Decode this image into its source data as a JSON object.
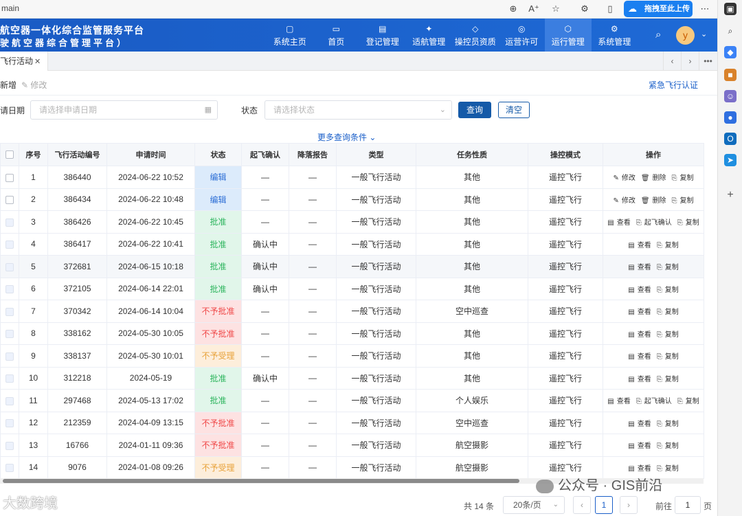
{
  "browser": {
    "url": "main",
    "upload_label": "拖拽至此上传"
  },
  "app": {
    "title_line1": "航空器一体化综合监管服务平台",
    "title_line2": "驶航空器综合管理平台）",
    "user_initial": "y"
  },
  "nav": [
    {
      "label": "系统主页",
      "icon": "home-screen-icon"
    },
    {
      "label": "首页",
      "icon": "monitor-icon"
    },
    {
      "label": "登记管理",
      "icon": "register-icon"
    },
    {
      "label": "适航管理",
      "icon": "drone-icon"
    },
    {
      "label": "操控员资质",
      "icon": "shield-icon"
    },
    {
      "label": "运营许可",
      "icon": "license-icon"
    },
    {
      "label": "运行管理",
      "icon": "operation-icon",
      "active": true
    },
    {
      "label": "系统管理",
      "icon": "gear-icon"
    }
  ],
  "tabs": {
    "active_tab": "飞行活动"
  },
  "toolbar": {
    "add_label": "新增",
    "edit_label": "修改",
    "emergency_label": "紧急飞行认证"
  },
  "search": {
    "date_label": "请日期",
    "date_placeholder": "请选择申请日期",
    "status_label": "状态",
    "status_placeholder": "请选择状态",
    "query_label": "查询",
    "clear_label": "清空",
    "more_label": "更多查询条件"
  },
  "table": {
    "headers": [
      "序号",
      "飞行活动编号",
      "申请时间",
      "状态",
      "起飞确认",
      "降落报告",
      "类型",
      "任务性质",
      "操控模式",
      "操作"
    ],
    "rows": [
      {
        "no": "1",
        "id": "386440",
        "time": "2024-06-22 10:52",
        "status": "编辑",
        "status_type": "edit",
        "takeoff": "—",
        "landing": "—",
        "type": "一般飞行活动",
        "task": "其他",
        "mode": "遥控飞行",
        "ops": [
          "修改",
          "删除",
          "复制"
        ],
        "checkbox": "on"
      },
      {
        "no": "2",
        "id": "386434",
        "time": "2024-06-22 10:48",
        "status": "编辑",
        "status_type": "edit",
        "takeoff": "—",
        "landing": "—",
        "type": "一般飞行活动",
        "task": "其他",
        "mode": "遥控飞行",
        "ops": [
          "修改",
          "删除",
          "复制"
        ],
        "checkbox": "on"
      },
      {
        "no": "3",
        "id": "386426",
        "time": "2024-06-22 10:45",
        "status": "批准",
        "status_type": "ok",
        "takeoff": "—",
        "landing": "—",
        "type": "一般飞行活动",
        "task": "其他",
        "mode": "遥控飞行",
        "ops": [
          "查看",
          "起飞确认",
          "复制"
        ],
        "checkbox": "dis"
      },
      {
        "no": "4",
        "id": "386417",
        "time": "2024-06-22 10:41",
        "status": "批准",
        "status_type": "ok",
        "takeoff": "确认中",
        "landing": "—",
        "type": "一般飞行活动",
        "task": "其他",
        "mode": "遥控飞行",
        "ops": [
          "查看",
          "复制"
        ],
        "checkbox": "dis"
      },
      {
        "no": "5",
        "id": "372681",
        "time": "2024-06-15 10:18",
        "status": "批准",
        "status_type": "ok",
        "takeoff": "确认中",
        "landing": "—",
        "type": "一般飞行活动",
        "task": "其他",
        "mode": "遥控飞行",
        "ops": [
          "查看",
          "复制"
        ],
        "checkbox": "dis",
        "highlight": true
      },
      {
        "no": "6",
        "id": "372105",
        "time": "2024-06-14 22:01",
        "status": "批准",
        "status_type": "ok",
        "takeoff": "确认中",
        "landing": "—",
        "type": "一般飞行活动",
        "task": "其他",
        "mode": "遥控飞行",
        "ops": [
          "查看",
          "复制"
        ],
        "checkbox": "dis"
      },
      {
        "no": "7",
        "id": "370342",
        "time": "2024-06-14 10:04",
        "status": "不予批准",
        "status_type": "rej",
        "takeoff": "—",
        "landing": "—",
        "type": "一般飞行活动",
        "task": "空中巡查",
        "mode": "遥控飞行",
        "ops": [
          "查看",
          "复制"
        ],
        "checkbox": "dis"
      },
      {
        "no": "8",
        "id": "338162",
        "time": "2024-05-30 10:05",
        "status": "不予批准",
        "status_type": "rej",
        "takeoff": "—",
        "landing": "—",
        "type": "一般飞行活动",
        "task": "其他",
        "mode": "遥控飞行",
        "ops": [
          "查看",
          "复制"
        ],
        "checkbox": "dis"
      },
      {
        "no": "9",
        "id": "338137",
        "time": "2024-05-30 10:01",
        "status": "不予受理",
        "status_type": "nr",
        "takeoff": "—",
        "landing": "—",
        "type": "一般飞行活动",
        "task": "其他",
        "mode": "遥控飞行",
        "ops": [
          "查看",
          "复制"
        ],
        "checkbox": "dis"
      },
      {
        "no": "10",
        "id": "312218",
        "time": "2024-05-19",
        "status": "批准",
        "status_type": "ok",
        "takeoff": "确认中",
        "landing": "—",
        "type": "一般飞行活动",
        "task": "其他",
        "mode": "遥控飞行",
        "ops": [
          "查看",
          "复制"
        ],
        "checkbox": "dis"
      },
      {
        "no": "11",
        "id": "297468",
        "time": "2024-05-13 17:02",
        "status": "批准",
        "status_type": "ok",
        "takeoff": "—",
        "landing": "—",
        "type": "一般飞行活动",
        "task": "个人娱乐",
        "mode": "遥控飞行",
        "ops": [
          "查看",
          "起飞确认",
          "复制"
        ],
        "checkbox": "dis"
      },
      {
        "no": "12",
        "id": "212359",
        "time": "2024-04-09 13:15",
        "status": "不予批准",
        "status_type": "rej",
        "takeoff": "—",
        "landing": "—",
        "type": "一般飞行活动",
        "task": "空中巡查",
        "mode": "遥控飞行",
        "ops": [
          "查看",
          "复制"
        ],
        "checkbox": "dis"
      },
      {
        "no": "13",
        "id": "16766",
        "time": "2024-01-11 09:36",
        "status": "不予批准",
        "status_type": "rej",
        "takeoff": "—",
        "landing": "—",
        "type": "一般飞行活动",
        "task": "航空摄影",
        "mode": "遥控飞行",
        "ops": [
          "查看",
          "复制"
        ],
        "checkbox": "dis"
      },
      {
        "no": "14",
        "id": "9076",
        "time": "2024-01-08 09:26",
        "status": "不予受理",
        "status_type": "nr",
        "takeoff": "—",
        "landing": "—",
        "type": "一般飞行活动",
        "task": "航空摄影",
        "mode": "遥控飞行",
        "ops": [
          "查看",
          "复制"
        ],
        "checkbox": "dis"
      }
    ]
  },
  "pager": {
    "total": "共 14 条",
    "page_size": "20条/页",
    "current": "1",
    "goto_label": "前往",
    "goto_value": "1",
    "page_suffix": "页"
  },
  "watermarks": {
    "left": "大数跨境",
    "right": "公众号 · GIS前沿"
  },
  "colors": {
    "header_bg": "#1a5fc9",
    "nav_active": "#3b7ee0",
    "primary_button": "#155aa8",
    "status_edit": "#2d6fd6",
    "status_ok": "#2bb45c",
    "status_reject": "#f04848",
    "status_not_received": "#e8a23a"
  }
}
